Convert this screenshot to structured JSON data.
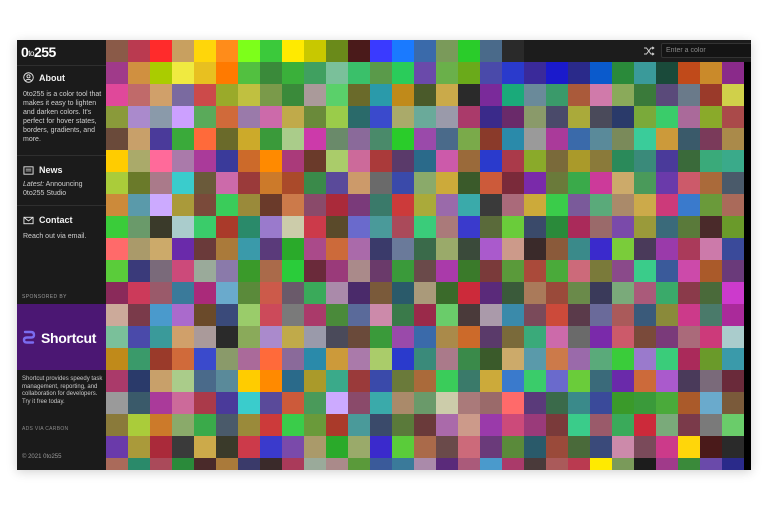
{
  "brand": {
    "name_prefix": "0",
    "name_to": "to",
    "name_suffix": "255"
  },
  "sidebar": {
    "about": {
      "title": "About",
      "icon": "person-icon",
      "text": "0to255 is a color tool that makes it easy to lighten and darken colors. It's perfect for hover states, borders, gradients, and more."
    },
    "news": {
      "title": "News",
      "icon": "newspaper-icon",
      "latest_label": "Latest:",
      "latest_text": " Announcing 0to255 Studio"
    },
    "contact": {
      "title": "Contact",
      "icon": "mail-icon",
      "text": "Reach out via email."
    },
    "sponsor": {
      "label": "SPONSORED BY",
      "ad_name": "Shortcut",
      "ad_text": "Shortcut provides speedy task management, reporting, and collaboration for developers. Try it free today.",
      "ad_via": "ADS VIA CARBON",
      "colors": {
        "banner": "#4b1773",
        "logo": "#7b6cf0"
      }
    },
    "copyright": "© 2021 0to255"
  },
  "toolbar": {
    "search_placeholder": "Enter a color",
    "search_value": "",
    "shuffle_icon": "shuffle-icon",
    "go_icon": "arrow-right-circle-icon"
  },
  "colors": [
    "#8a5a48",
    "#ba3a50",
    "#ff2b2b",
    "#c8a060",
    "#ffd60a",
    "#ff8c1a",
    "#7dff1a",
    "#3bc93b",
    "#ffea00",
    "#c8c800",
    "#6a8a1a",
    "#4a1a1a",
    "#3a3aff",
    "#1a7aff",
    "#3a6aaa",
    "#7a9a5a",
    "#2acc2a",
    "#4a6a8a",
    "#2a2a2a",
    "#1c1c1c",
    "#1c1c1c",
    "#1c1c1c",
    "#1c1c1c",
    "#1c1c1c",
    "#1c1c1c",
    "#1c1c1c",
    "#1c1c1c",
    "#1c1c1c",
    "#1c1c1c",
    "#a03a8a",
    "#d09040",
    "#aacc00",
    "#f0ea40",
    "#e8c020",
    "#ff7a00",
    "#52c040",
    "#3a8a3a",
    "#3ab03a",
    "#40a060",
    "#7ac09a",
    "#3ac06a",
    "#5a9a4a",
    "#2acc5a",
    "#6a4aaa",
    "#6ab04a",
    "#6aaa1a",
    "#4a4aaa",
    "#2a3acc",
    "#3a2a9a",
    "#1a1acc",
    "#2a2a8a",
    "#0a5acc",
    "#2a8a3a",
    "#3a9a9a",
    "#1a4a3a",
    "#c04a1a",
    "#ca8a2a",
    "#8a2a8a",
    "#e0489a",
    "#c06a6a",
    "#d0a06a",
    "#7a6aa0",
    "#cc4a4a",
    "#9aaa2a",
    "#c0c040",
    "#7a9a4a",
    "#3a8a3a",
    "#aa9a9a",
    "#5ad06a",
    "#6a6a2a",
    "#2a9aaa",
    "#c08a1a",
    "#4a5a2a",
    "#caaa4a",
    "#2a2a2a",
    "#7a2a9a",
    "#1aaa7a",
    "#6a8a9a",
    "#3a9a6a",
    "#aa5a3a",
    "#d07aaa",
    "#8aaa5a",
    "#3a7a3a",
    "#5a4a7a",
    "#6a7a8a",
    "#9a3a2a",
    "#d0d04a",
    "#8a9a3a",
    "#aa8acc",
    "#8a9aaa",
    "#cca0ff",
    "#5aaa5a",
    "#d06a3a",
    "#9a7aaa",
    "#cc6aaa",
    "#c0aa4a",
    "#6a8a3a",
    "#9acc4a",
    "#2a6a6a",
    "#3a4acc",
    "#aaaa6a",
    "#6aaa9a",
    "#9a9aaa",
    "#aa3a6a",
    "#3a2a8a",
    "#6a2a6a",
    "#8a9a6a",
    "#4a4a6a",
    "#aaaa3a",
    "#4a4a5a",
    "#2a3a6a",
    "#7aaa3a",
    "#3acc6a",
    "#aa6a9a",
    "#8aaa2a",
    "#aa4a4a",
    "#6a4a3a",
    "#c8a06a",
    "#4a3a9a",
    "#3aaa3a",
    "#ff6a3a",
    "#6a6a2a",
    "#ccaa2a",
    "#3a9a3a",
    "#aacc8a",
    "#cc3aaa",
    "#6a8a6a",
    "#8a6a9a",
    "#4a8a6a",
    "#2acc2a",
    "#9a4aaa",
    "#4a6a8a",
    "#7aaa4a",
    "#8a3a2a",
    "#2a8aaa",
    "#9a9a9a",
    "#aa3a9a",
    "#3a6aaa",
    "#5a8a9a",
    "#7a8a5a",
    "#3acc9a",
    "#cc9a3a",
    "#3a5a6a",
    "#7a3a5a",
    "#aa8a4a",
    "#ffcc00",
    "#aaaa6a",
    "#ff6a9a",
    "#aa7aaa",
    "#aa3a9a",
    "#3a3a9a",
    "#cc6a2a",
    "#ff8a00",
    "#aa3a7a",
    "#6a3a2a",
    "#aacc6a",
    "#cc6a9a",
    "#aa3a3a",
    "#5a3a6a",
    "#2a6a8a",
    "#cc5aaa",
    "#9a6a3a",
    "#2a3acc",
    "#aa3a4a",
    "#8aaa2a",
    "#7a6a3a",
    "#aa9a2a",
    "#8a7a3a",
    "#2a8a5a",
    "#3a8a7a",
    "#4a3a9a",
    "#3a6a3a",
    "#3aaa7a",
    "#3aaa8a",
    "#aacc3a",
    "#6a7a2a",
    "#aa7a8a",
    "#3acccc",
    "#6a5a3a",
    "#cc6aaa",
    "#9a3a3a",
    "#cc7a2a",
    "#aa4a2a",
    "#3a8a4a",
    "#5a4a9a",
    "#cc9a6a",
    "#6a6a6a",
    "#3a4aaa",
    "#8aaa6a",
    "#ccaa3a",
    "#3a5a2a",
    "#cc5a3a",
    "#7a2a3a",
    "#7a2aaa",
    "#6a7a3a",
    "#3aaa4a",
    "#cc3a9a",
    "#ccaa6a",
    "#4a9a5a",
    "#6a3aaa",
    "#cc5a6a",
    "#aa6a3a",
    "#4a5a6a",
    "#cc8a3a",
    "#5a9aaa",
    "#ccaaff",
    "#aa9a3a",
    "#7a4a3a",
    "#3acc5a",
    "#9a8a3a",
    "#6a3a2a",
    "#cc7a4a",
    "#8a4a6a",
    "#aa2a3a",
    "#7a3a7a",
    "#3a7a6a",
    "#cc3a3a",
    "#aaaa3a",
    "#9a6aaa",
    "#3aaaaa",
    "#3a3a3a",
    "#aa6a7a",
    "#ccaa3a",
    "#3acc4a",
    "#7a5a9a",
    "#5aaa7a",
    "#aa8a6a",
    "#ccaa4a",
    "#cc3a7a",
    "#3a7acc",
    "#6a9a3a",
    "#aa6a5a",
    "#3acc3a",
    "#6a9a6a",
    "#3a3a2a",
    "#aacccc",
    "#3acc6a",
    "#aa3a2a",
    "#2a8a6a",
    "#9a7acc",
    "#ccccaa",
    "#cc3a4a",
    "#5a4a2a",
    "#6a6acc",
    "#4a9a9a",
    "#aa4a5a",
    "#3acc7a",
    "#aa7a7a",
    "#3a3acc",
    "#5a6a3a",
    "#6acc3a",
    "#3a4a6a",
    "#2a8a3a",
    "#aa2a5a",
    "#9a6a6a",
    "#7a4aaa",
    "#9a9a3a",
    "#3a6a7a",
    "#5a7a3a",
    "#4a2a2a",
    "#6a9a2a",
    "#ff6a6a",
    "#aa9a6a",
    "#ccaa6a",
    "#6a2aaa",
    "#6a3a3a",
    "#aa7a3a",
    "#3a9aaa",
    "#5a3a7a",
    "#2aaa2a",
    "#aa4a8a",
    "#cc6a3a",
    "#aa6aaa",
    "#3a3a6a",
    "#6a7a9a",
    "#3a6a4a",
    "#9aaa6a",
    "#3a4a3a",
    "#aa5acc",
    "#cc9a8a",
    "#3a2a2a",
    "#8a5a3a",
    "#3a8a8a",
    "#3a2acc",
    "#7acc3a",
    "#4a3a5a",
    "#9a3aaa",
    "#aa3a5a",
    "#cc7aaa",
    "#3a4a9a",
    "#5acc3a",
    "#3a3a7a",
    "#7a6a7a",
    "#cc4a7a",
    "#9aaa9a",
    "#8a7aaa",
    "#3a9a2a",
    "#aa6a4a",
    "#2acc3a",
    "#6a2a3a",
    "#9a3a7a",
    "#aa8a8a",
    "#6a3a6a",
    "#3a9a3a",
    "#6a4a4a",
    "#aa3aaa",
    "#3a7a2a",
    "#7a3a3a",
    "#5a9a3a",
    "#aa4a3a",
    "#4aaa3a",
    "#cc6a7a",
    "#7a7a3a",
    "#8a4a8a",
    "#3acc8a",
    "#3a5a9a",
    "#cc4aaa",
    "#aa5a2a",
    "#6a3a7a",
    "#8a2a5a",
    "#cc3a5a",
    "#9a5a6a",
    "#3a7a9a",
    "#aa2a7a",
    "#6aaacc",
    "#5a8a3a",
    "#cc5a4a",
    "#6a5a6a",
    "#3aaa5a",
    "#aa8aaa",
    "#4a2a6a",
    "#7a5a3a",
    "#2a5a6a",
    "#aa9a7a",
    "#3a6a2a",
    "#cc2a3a",
    "#5a2a7a",
    "#3a5a3a",
    "#aa7a5a",
    "#9a4a3a",
    "#6a8a4a",
    "#3a3a5a",
    "#7aaa7a",
    "#aa5a7a",
    "#3aaa6a",
    "#8a3a4a",
    "#4a6a3a",
    "#cc3acc",
    "#ccaa9a",
    "#7a3a4a",
    "#4a9acc",
    "#aa6acc",
    "#6a4a2a",
    "#3a4a7a",
    "#9acc6a",
    "#cc4a5a",
    "#7a7a7a",
    "#aa3a6a",
    "#4a8a3a",
    "#5a6a9a",
    "#cc8aaa",
    "#3a7a4a",
    "#9a2a4a",
    "#6acc6a",
    "#4a3a3a",
    "#aa9aaa",
    "#3a8aaa",
    "#7a4a5a",
    "#cc4a3a",
    "#5a3a4a",
    "#6a6a9a",
    "#aa5a5a",
    "#3a5a7a",
    "#8a8a3a",
    "#cc3a8a",
    "#4a7a6a",
    "#aa2a9a"
  ]
}
